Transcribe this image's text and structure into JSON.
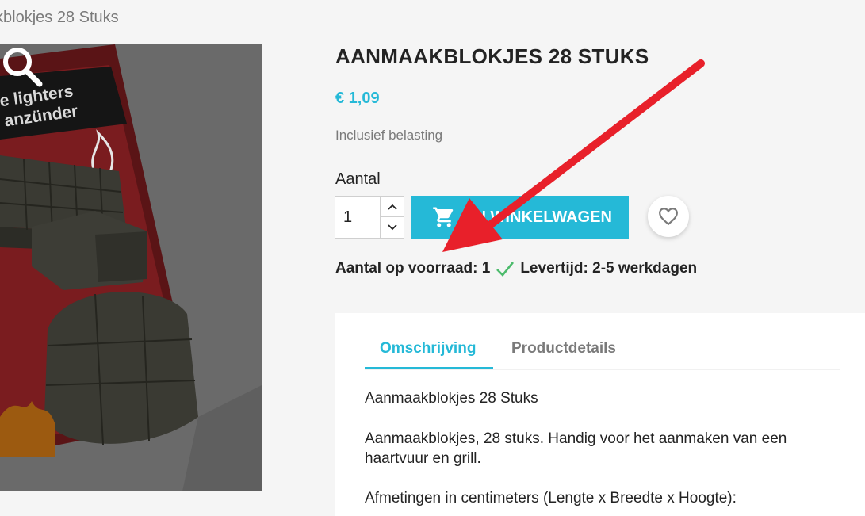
{
  "breadcrumb": {
    "current": "kblokjes 28 Stuks"
  },
  "product": {
    "title": "AANMAAKBLOKJES 28 STUKS",
    "price": "€ 1,09",
    "tax_note": "Inclusief belasting",
    "image_texts": {
      "line1": "e lighters",
      "line2": "anzünder"
    }
  },
  "quantity": {
    "label": "Aantal",
    "value": "1"
  },
  "cart_button": {
    "label": "IN WINKELWAGEN"
  },
  "stock": {
    "in_stock_text": "Aantal op voorraad: 1",
    "delivery_text": "Levertijd: 2-5 werkdagen"
  },
  "tabs": [
    {
      "label": "Omschrijving",
      "active": true
    },
    {
      "label": "Productdetails",
      "active": false
    }
  ],
  "description": {
    "p1": "Aanmaakblokjes 28 Stuks",
    "p2": "Aanmaakblokjes, 28 stuks. Handig voor het aanmaken van een haartvuur en grill.",
    "p3": "Afmetingen in centimeters (Lengte x Breedte x Hoogte):"
  },
  "icons": {
    "zoom": "magnifier-icon",
    "cart": "cart-icon",
    "wishlist": "heart-icon",
    "stock": "check-icon",
    "spin_up": "chevron-up-icon",
    "spin_down": "chevron-down-icon"
  },
  "colors": {
    "accent": "#25b9d7",
    "check": "#4cbb6c",
    "annotation_arrow": "#e8202a",
    "text": "#232323",
    "muted": "#7a7a7a"
  }
}
